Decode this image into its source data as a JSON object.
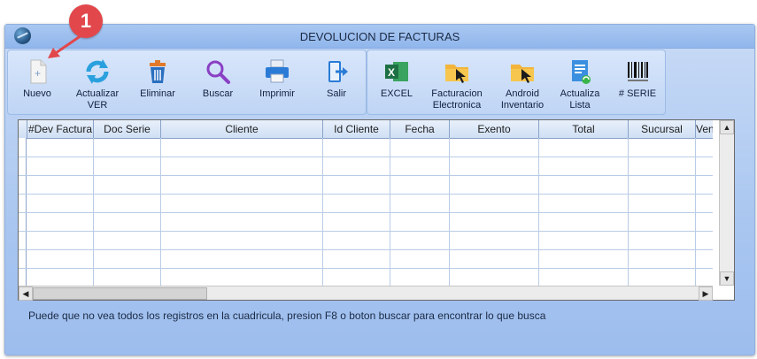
{
  "window": {
    "title": "DEVOLUCION DE FACTURAS"
  },
  "callout": {
    "number": "1"
  },
  "toolbar_left": [
    {
      "label": "Nuevo",
      "icon": "new-document-icon"
    },
    {
      "label": "Actualizar\nVER",
      "icon": "refresh-icon"
    },
    {
      "label": "Eliminar",
      "icon": "trash-icon"
    },
    {
      "label": "Buscar",
      "icon": "search-icon"
    },
    {
      "label": "Imprimir",
      "icon": "printer-icon"
    },
    {
      "label": "Salir",
      "icon": "exit-icon"
    }
  ],
  "toolbar_right": [
    {
      "label": "EXCEL",
      "icon": "excel-icon"
    },
    {
      "label": "Facturacion\nElectronica",
      "icon": "folder-cursor-icon"
    },
    {
      "label": "Android\nInventario",
      "icon": "folder-cursor-icon"
    },
    {
      "label": "Actualiza\nLista",
      "icon": "update-list-icon"
    },
    {
      "label": "# SERIE",
      "icon": "barcode-icon"
    }
  ],
  "grid": {
    "columns": [
      "#Dev Factura",
      "Doc Serie",
      "Cliente",
      "Id Cliente",
      "Fecha",
      "Exento",
      "Total",
      "Sucursal",
      "Ven"
    ]
  },
  "footer": {
    "note": "Puede que no vea todos los registros en la cuadricula, presion F8 o boton buscar para encontrar lo que busca"
  }
}
